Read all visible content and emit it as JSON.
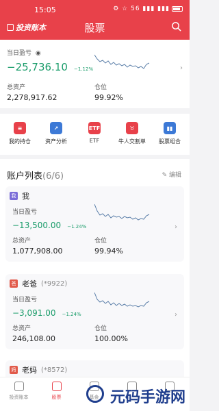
{
  "status": {
    "time": "15:05",
    "icons": "⚙ ☆ 56 ▮▮▮ ▮▮▮",
    "battery": "83"
  },
  "header": {
    "logo": "投资账本",
    "title": "股票"
  },
  "summary": {
    "today_label": "当日盈亏",
    "today_value": "−25,736.10",
    "today_pct": "−1.12%",
    "assets_label": "总资产",
    "assets_value": "2,278,917.62",
    "position_label": "仓位",
    "position_value": "99.92%"
  },
  "quick_menu": [
    {
      "label": "我的持仓",
      "icon": "holdings-icon",
      "color": "#e8414a",
      "glyph": "≡"
    },
    {
      "label": "资产分析",
      "icon": "trend-icon",
      "color": "#3c79d6",
      "glyph": "↗"
    },
    {
      "label": "ETF",
      "icon": "etf-icon",
      "color": "#e8414a",
      "glyph": "ETF"
    },
    {
      "label": "牛人交割单",
      "icon": "bull-icon",
      "color": "#e8414a",
      "glyph": "♉"
    },
    {
      "label": "股票组合",
      "icon": "portfolio-icon",
      "color": "#3c79d6",
      "glyph": "▮▮"
    }
  ],
  "accounts": {
    "title": "账户列表",
    "count": "(6/6)",
    "edit_label": "编辑",
    "items": [
      {
        "name": "我",
        "sub": "",
        "badge": "我",
        "badge_color": "#7b6dd8",
        "today_label": "当日盈亏",
        "today_value": "−13,500.00",
        "today_pct": "−1.24%",
        "assets_label": "总资产",
        "assets_value": "1,077,908.00",
        "position_label": "仓位",
        "position_value": "99.94%"
      },
      {
        "name": "老爸",
        "sub": "(*9922)",
        "badge": "爸",
        "badge_color": "#e15a4a",
        "today_label": "当日盈亏",
        "today_value": "−3,091.00",
        "today_pct": "−1.24%",
        "assets_label": "总资产",
        "assets_value": "246,108.00",
        "position_label": "仓位",
        "position_value": "100.00%"
      },
      {
        "name": "老妈",
        "sub": "(*8572)",
        "badge": "妈",
        "badge_color": "#e15a4a"
      }
    ]
  },
  "tabbar": [
    {
      "label": "投资账本",
      "active": false
    },
    {
      "label": "股票",
      "active": true
    },
    {
      "label": "基金",
      "active": false
    },
    {
      "label": "",
      "active": false
    },
    {
      "label": "",
      "active": false
    }
  ],
  "watermark": {
    "text": "元码手游网"
  },
  "colors": {
    "primary": "#e8414a",
    "down": "#1a9c6a",
    "bg": "#f3f3f5"
  }
}
